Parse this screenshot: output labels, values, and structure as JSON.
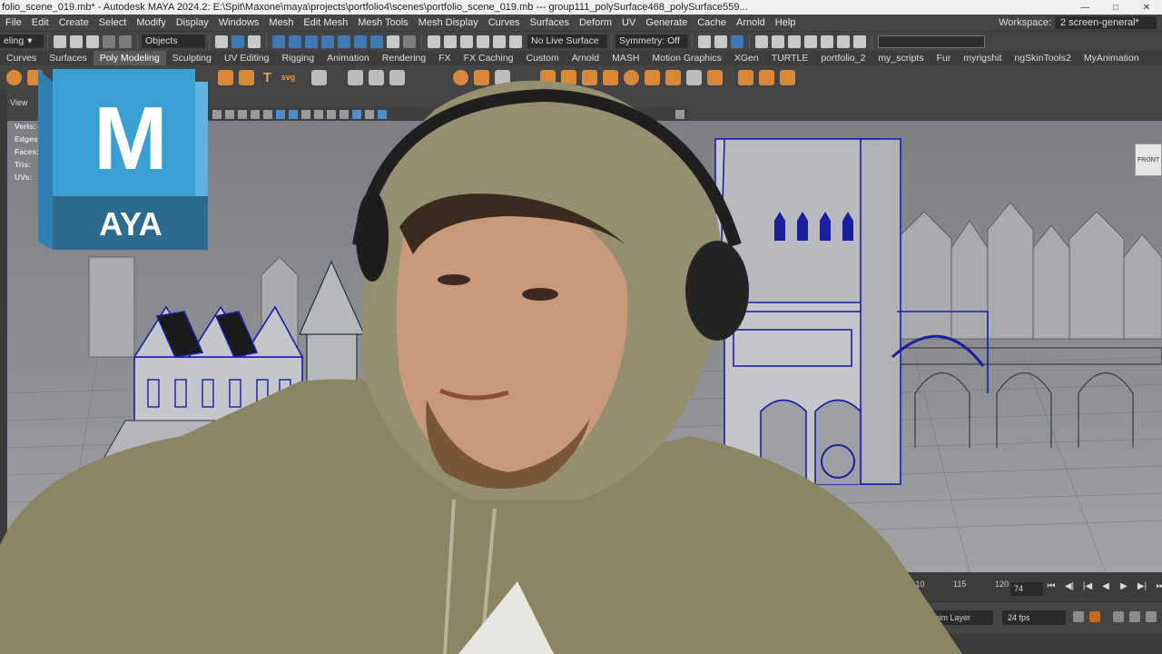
{
  "window": {
    "title": "folio_scene_019.mb* - Autodesk MAYA 2024.2: E:\\Spit\\Maxone\\maya\\projects\\portfolio4\\scenes\\portfolio_scene_019.mb  ---  group111_polySurface468_polySurface559..."
  },
  "menubar": {
    "items": [
      "File",
      "Edit",
      "Create",
      "Select",
      "Modify",
      "Display",
      "Windows",
      "Mesh",
      "Edit Mesh",
      "Mesh Tools",
      "Mesh Display",
      "Curves",
      "Surfaces",
      "Deform",
      "UV",
      "Generate",
      "Cache",
      "Arnold",
      "Help"
    ],
    "workspace_label": "Workspace:",
    "workspace_value": "2 screen-general*"
  },
  "statusline": {
    "menuset": "eling",
    "selection_mode": "Objects",
    "live_surface": "No Live Surface",
    "symmetry": "Symmetry: Off"
  },
  "shelf_tabs": {
    "items": [
      "Curves",
      "Surfaces",
      "Poly Modeling",
      "Sculpting",
      "UV Editing",
      "Rigging",
      "Animation",
      "Rendering",
      "FX",
      "FX Caching",
      "Custom",
      "Arnold",
      "MASH",
      "Motion Graphics",
      "XGen",
      "TURTLE",
      "portfolio_2",
      "my_scripts",
      "Fur",
      "myrigshit",
      "ngSkinTools2",
      "MyAnimation"
    ],
    "active": "Poly Modeling"
  },
  "shelf": {
    "text_icon": "T",
    "svg_icon": "svg"
  },
  "viewport": {
    "panel_menu": "View",
    "hud": {
      "verts": "Verts:",
      "edges": "Edges:",
      "faces": "Faces:",
      "tris": "Tris:",
      "uvs": "UVs:"
    },
    "view_cube": "FRONT"
  },
  "timeslider": {
    "ticks": [
      "110",
      "115",
      "120"
    ],
    "current_frame": "74"
  },
  "rangebar": {
    "anim_layer": "No Anim Layer",
    "fps": "24 fps"
  },
  "logo": {
    "letter": "M",
    "text": "AYA"
  },
  "colors": {
    "maya_blue": "#3aa0d4",
    "maya_dark": "#2d6a8e",
    "ui_bg": "#444444",
    "wireframe_blue": "#1a1f9e",
    "hoodie_olive": "#8a8563"
  }
}
